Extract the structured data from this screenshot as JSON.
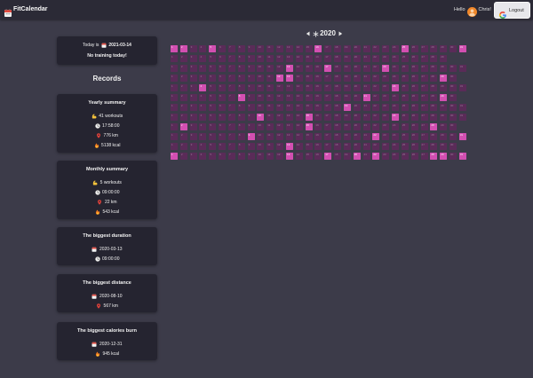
{
  "header": {
    "app_title": "FitCalendar",
    "greeting": "Hello",
    "user_name": "Chris!",
    "logout_label": "Logout"
  },
  "today": {
    "prefix": "Today is",
    "date": "2021-03-14",
    "status": "No training today!"
  },
  "records_title": "Records",
  "yearly": {
    "title": "Yearly summary",
    "items": [
      {
        "icon": "muscle-icon",
        "text": "41 workouts"
      },
      {
        "icon": "clock-icon",
        "text": "17:58:00"
      },
      {
        "icon": "distance-icon",
        "text": "776 km"
      },
      {
        "icon": "fire-icon",
        "text": "5138 kcal"
      }
    ]
  },
  "monthly": {
    "title": "Monthly summary",
    "items": [
      {
        "icon": "muscle-icon",
        "text": "5 workouts"
      },
      {
        "icon": "clock-icon",
        "text": "09:00:00"
      },
      {
        "icon": "distance-icon",
        "text": "22 km"
      },
      {
        "icon": "fire-icon",
        "text": "543 kcal"
      }
    ]
  },
  "biggest_duration": {
    "title": "The biggest duration",
    "items": [
      {
        "icon": "calendar-icon",
        "text": "2020-03-13"
      },
      {
        "icon": "clock-icon",
        "text": "09:00:00"
      }
    ]
  },
  "biggest_distance": {
    "title": "The biggest distance",
    "items": [
      {
        "icon": "calendar-icon",
        "text": "2020-08-10"
      },
      {
        "icon": "distance-icon",
        "text": "567 km"
      }
    ]
  },
  "biggest_calories": {
    "title": "The biggest calories burn",
    "items": [
      {
        "icon": "calendar-icon",
        "text": "2020-12-31"
      },
      {
        "icon": "fire-icon",
        "text": "945 kcal"
      }
    ]
  },
  "calendar": {
    "year": "2020",
    "workout_days": [
      [
        1,
        2,
        5,
        16,
        25,
        31
      ],
      [],
      [
        13,
        17,
        23
      ],
      [
        12,
        13,
        29
      ],
      [
        4,
        24
      ],
      [
        8,
        21,
        29
      ],
      [
        19
      ],
      [
        10,
        15,
        24
      ],
      [
        2,
        15,
        28
      ],
      [
        9,
        22,
        31
      ],
      [
        13
      ],
      [
        1,
        13,
        17,
        20,
        22,
        28,
        29,
        31
      ]
    ]
  },
  "colors": {
    "page_bg": "#3c3b49",
    "header_bg": "#2b2a36",
    "card_bg": "#252430",
    "cell_empty": "#5a2b58",
    "cell_workout": "#d24fb1",
    "avatar": "#f0872a"
  }
}
